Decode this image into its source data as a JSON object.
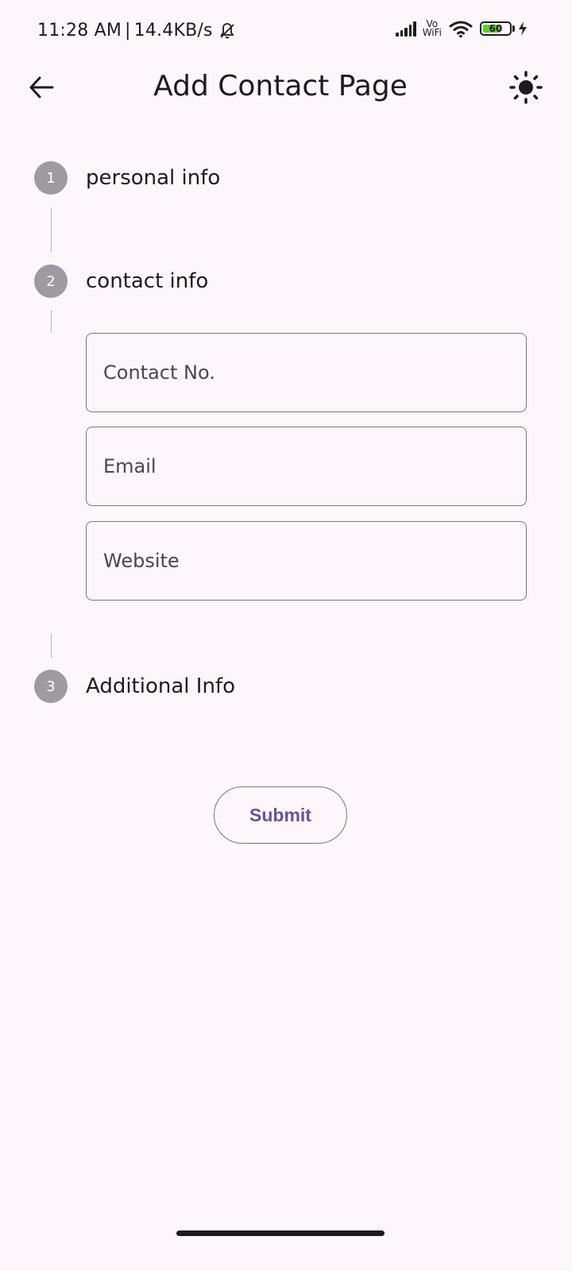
{
  "status_bar": {
    "time": "11:28 AM",
    "separator": "|",
    "network_speed": "14.4KB/s",
    "vowifi_top": "Vo",
    "vowifi_bottom": "WiFi",
    "battery_level": "60",
    "icons": [
      "bell-off-icon",
      "signal-icon",
      "vowifi-icon",
      "wifi-icon",
      "battery-icon",
      "charging-icon"
    ]
  },
  "app_bar": {
    "title": "Add Contact Page",
    "back_icon": "arrow-back-icon",
    "theme_icon": "sun-icon"
  },
  "stepper": {
    "steps": [
      {
        "number": "1",
        "label": "personal info",
        "state": "collapsed"
      },
      {
        "number": "2",
        "label": "contact info",
        "state": "active"
      },
      {
        "number": "3",
        "label": "Additional Info",
        "state": "collapsed"
      }
    ],
    "active_step_fields": [
      {
        "placeholder": "Contact No.",
        "value": ""
      },
      {
        "placeholder": "Email",
        "value": ""
      },
      {
        "placeholder": "Website",
        "value": ""
      }
    ]
  },
  "actions": {
    "submit_label": "Submit"
  },
  "colors": {
    "background": "#fdf7fc",
    "step_circle": "#9e9aa2",
    "accent": "#65558f",
    "outline": "#7a757f",
    "battery_fill": "#63c93a"
  }
}
